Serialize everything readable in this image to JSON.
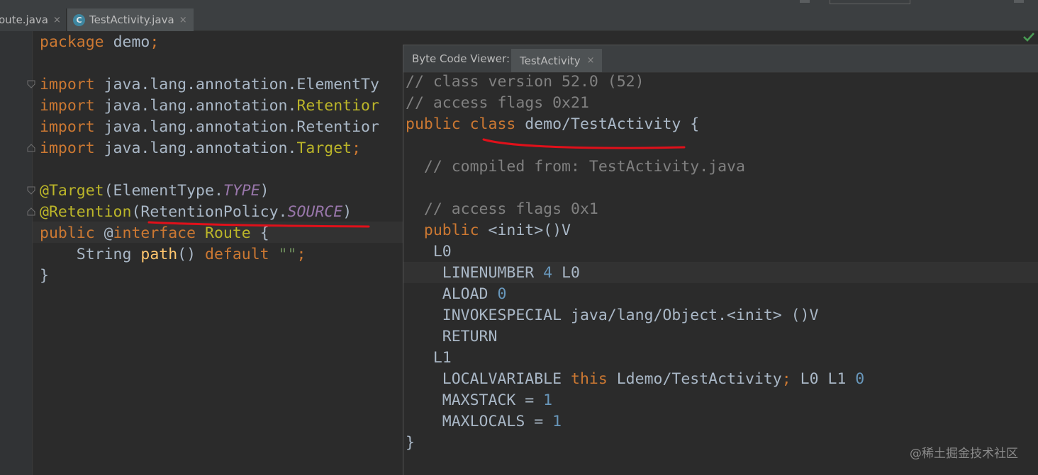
{
  "tabs": [
    {
      "label": "oute.java",
      "close": "×"
    },
    {
      "label": "TestActivity.java",
      "close": "×",
      "icon": "class-icon",
      "icon_text": "C"
    }
  ],
  "editor": {
    "lines": [
      [
        {
          "t": "package ",
          "c": "kw"
        },
        {
          "t": "demo",
          "c": ""
        },
        {
          "t": ";",
          "c": "kw"
        }
      ],
      [],
      [
        {
          "t": "import ",
          "c": "kw"
        },
        {
          "t": "java.lang.annotation.ElementTy",
          "c": ""
        }
      ],
      [
        {
          "t": "import ",
          "c": "kw"
        },
        {
          "t": "java.lang.annotation.",
          "c": ""
        },
        {
          "t": "Retentior",
          "c": "ann"
        }
      ],
      [
        {
          "t": "import ",
          "c": "kw"
        },
        {
          "t": "java.lang.annotation.Retentior",
          "c": ""
        }
      ],
      [
        {
          "t": "import ",
          "c": "kw"
        },
        {
          "t": "java.lang.annotation.",
          "c": ""
        },
        {
          "t": "Target",
          "c": "ann"
        },
        {
          "t": ";",
          "c": "kw"
        }
      ],
      [],
      [
        {
          "t": "@Target",
          "c": "ann"
        },
        {
          "t": "(ElementType.",
          "c": ""
        },
        {
          "t": "TYPE",
          "c": "stat"
        },
        {
          "t": ")",
          "c": ""
        }
      ],
      [
        {
          "t": "@Retention",
          "c": "ann"
        },
        {
          "t": "(RetentionPolicy.",
          "c": ""
        },
        {
          "t": "SOURCE",
          "c": "stat"
        },
        {
          "t": ")",
          "c": ""
        }
      ],
      [
        {
          "t": "public ",
          "c": "kw"
        },
        {
          "t": "@",
          "c": ""
        },
        {
          "t": "interface ",
          "c": "kw"
        },
        {
          "t": "Route",
          "c": "ann"
        },
        {
          "t": " {",
          "c": ""
        }
      ],
      [
        {
          "t": "    String ",
          "c": ""
        },
        {
          "t": "path",
          "c": "fn"
        },
        {
          "t": "() ",
          "c": ""
        },
        {
          "t": "default ",
          "c": "kw"
        },
        {
          "t": "\"\"",
          "c": "str"
        },
        {
          "t": ";",
          "c": "kw"
        }
      ],
      [
        {
          "t": "}",
          "c": ""
        }
      ]
    ]
  },
  "bytecode_viewer": {
    "title": "Byte Code Viewer:",
    "tab_label": "TestActivity",
    "tab_close": "×",
    "lines": [
      [
        {
          "t": "// class version 52.0 (52)",
          "c": "cmt"
        }
      ],
      [
        {
          "t": "// access flags 0x21",
          "c": "cmt"
        }
      ],
      [
        {
          "t": "public ",
          "c": "kw"
        },
        {
          "t": "class ",
          "c": "kw"
        },
        {
          "t": "demo/TestActivity {",
          "c": ""
        }
      ],
      [],
      [
        {
          "t": "  // compiled from: TestActivity.java",
          "c": "cmt"
        }
      ],
      [],
      [
        {
          "t": "  // access flags 0x1",
          "c": "cmt"
        }
      ],
      [
        {
          "t": "  public ",
          "c": "kw"
        },
        {
          "t": "<init>()V",
          "c": ""
        }
      ],
      [
        {
          "t": "   L0",
          "c": ""
        }
      ],
      [
        {
          "t": "    LINENUMBER ",
          "c": ""
        },
        {
          "t": "4",
          "c": "num"
        },
        {
          "t": " L0",
          "c": ""
        }
      ],
      [
        {
          "t": "    ALOAD ",
          "c": ""
        },
        {
          "t": "0",
          "c": "num"
        }
      ],
      [
        {
          "t": "    INVOKESPECIAL java/lang/Object.<init> ()V",
          "c": ""
        }
      ],
      [
        {
          "t": "    RETURN",
          "c": ""
        }
      ],
      [
        {
          "t": "   L1",
          "c": ""
        }
      ],
      [
        {
          "t": "    LOCALVARIABLE ",
          "c": ""
        },
        {
          "t": "this ",
          "c": "kw"
        },
        {
          "t": "Ldemo/TestActivity",
          "c": ""
        },
        {
          "t": "; ",
          "c": "kw"
        },
        {
          "t": "L0 L1 ",
          "c": ""
        },
        {
          "t": "0",
          "c": "num"
        }
      ],
      [
        {
          "t": "    MAXSTACK = ",
          "c": ""
        },
        {
          "t": "1",
          "c": "num"
        }
      ],
      [
        {
          "t": "    MAXLOCALS = ",
          "c": ""
        },
        {
          "t": "1",
          "c": "num"
        }
      ],
      [
        {
          "t": "}",
          "c": ""
        }
      ]
    ]
  },
  "status": {
    "inspection_icon": "check-icon"
  },
  "watermark": "@稀土掘金技术社区",
  "colors": {
    "background": "#2b2b2b",
    "keyword": "#cc7832",
    "annotation": "#bbb529",
    "static_field": "#9876aa",
    "function": "#ffc66d",
    "string": "#6a8759",
    "number": "#6897bb",
    "comment": "#808080",
    "text": "#a9b7c6",
    "underline_markup": "#e0101a"
  }
}
